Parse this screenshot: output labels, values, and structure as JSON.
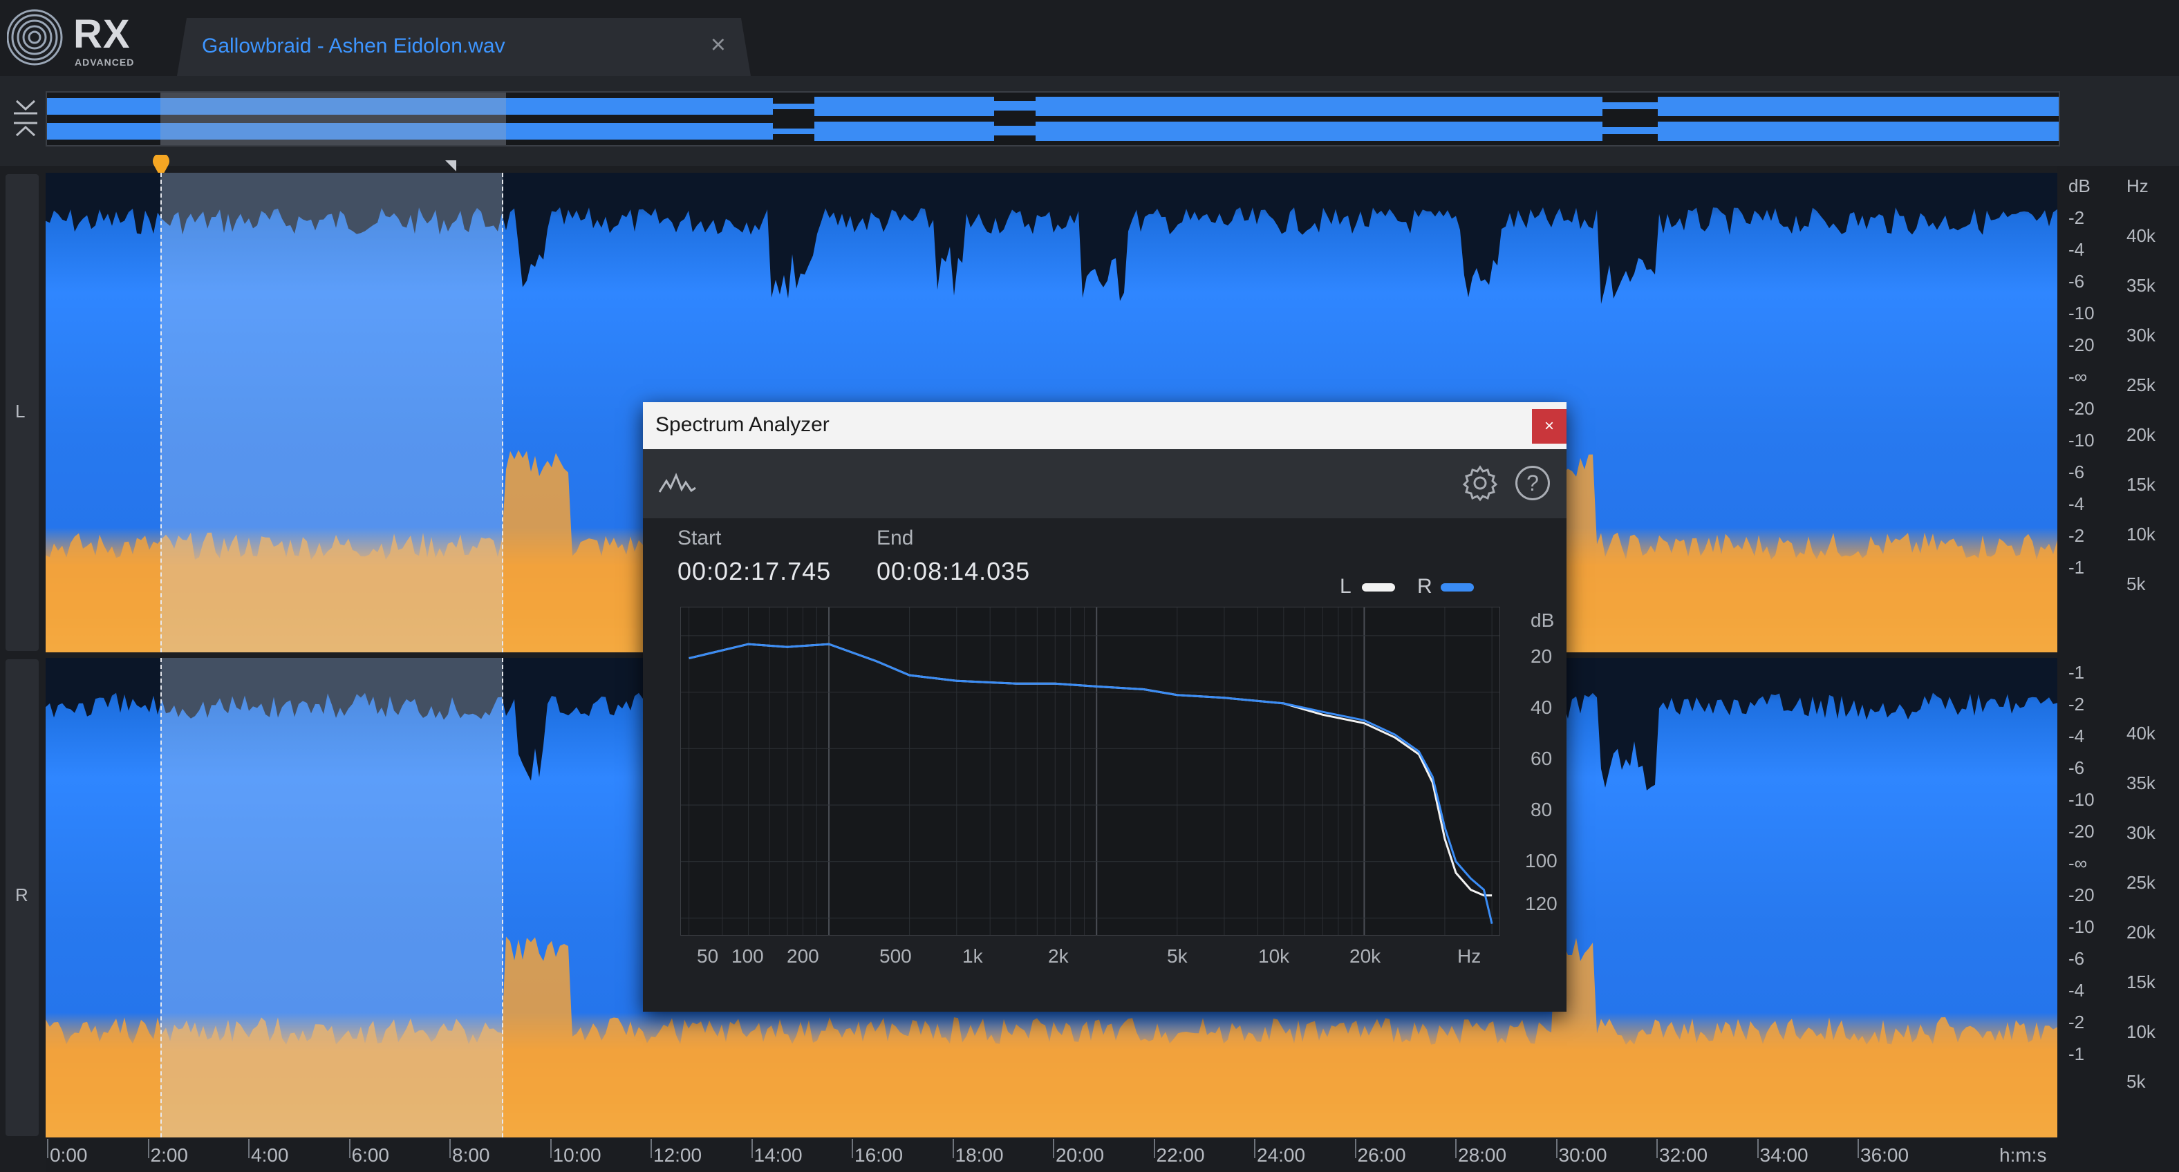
{
  "app": {
    "logo_text": "RX",
    "edition": "ADVANCED",
    "tab_title": "Gallowbraid - Ashen Eidolon.wav",
    "tab_close": "×"
  },
  "channels": {
    "left": "L",
    "right": "R"
  },
  "scales": {
    "L": {
      "db": [
        "dB",
        "-2",
        "-4",
        "-6",
        "-10",
        "-20",
        "-∞",
        "-20",
        "-10",
        "-6",
        "-4",
        "-2",
        "-1"
      ],
      "hz": [
        "Hz",
        "40k",
        "35k",
        "30k",
        "25k",
        "20k",
        "15k",
        "10k",
        "5k"
      ]
    },
    "R": {
      "db": [
        "-1",
        "-2",
        "-4",
        "-6",
        "-10",
        "-20",
        "-∞",
        "-20",
        "-10",
        "-6",
        "-4",
        "-2",
        "-1"
      ],
      "hz": [
        "40k",
        "35k",
        "30k",
        "25k",
        "20k",
        "15k",
        "10k",
        "5k"
      ]
    }
  },
  "timeline": {
    "labels": [
      "0:00",
      "2:00",
      "4:00",
      "6:00",
      "8:00",
      "10:00",
      "12:00",
      "14:00",
      "16:00",
      "18:00",
      "20:00",
      "22:00",
      "24:00",
      "26:00",
      "28:00",
      "30:00",
      "32:00",
      "34:00",
      "36:00"
    ],
    "unit": "h:m:s"
  },
  "spectrum_analyzer": {
    "title": "Spectrum Analyzer",
    "close": "×",
    "help": "?",
    "start_label": "Start",
    "start_value": "00:02:17.745",
    "end_label": "End",
    "end_value": "00:08:14.035",
    "legend_L": "L",
    "legend_R": "R",
    "color_L": "#f2f2f2",
    "color_R": "#3a8cf5",
    "db_unit": "dB",
    "db_ticks": [
      "20",
      "40",
      "60",
      "80",
      "100",
      "120"
    ],
    "hz_ticks": [
      "50",
      "100",
      "200",
      "500",
      "1k",
      "2k",
      "5k",
      "10k",
      "20k"
    ],
    "hz_unit": "Hz"
  },
  "chart_data": {
    "type": "line",
    "xscale": "log",
    "xlabel": "Hz",
    "ylabel": "dB",
    "x": [
      30,
      50,
      70,
      100,
      150,
      200,
      300,
      500,
      700,
      1000,
      1500,
      2000,
      3000,
      5000,
      7000,
      10000,
      13000,
      16000,
      18000,
      20000,
      22000,
      25000,
      28000,
      30000
    ],
    "series": [
      {
        "name": "L",
        "color": "#f2f2f2",
        "values": [
          28,
          23,
          24,
          23,
          29,
          34,
          36,
          37,
          37,
          38,
          39,
          41,
          42,
          44,
          48,
          51,
          56,
          62,
          72,
          92,
          104,
          110,
          112,
          112
        ]
      },
      {
        "name": "R",
        "color": "#3a8cf5",
        "values": [
          28,
          23,
          24,
          23,
          29,
          34,
          36,
          37,
          37,
          38,
          39,
          41,
          42,
          44,
          47,
          50,
          55,
          61,
          70,
          88,
          100,
          106,
          110,
          122
        ]
      }
    ],
    "ylim": [
      126,
      10
    ],
    "xlim": [
      28,
      32000
    ],
    "grid": true
  }
}
